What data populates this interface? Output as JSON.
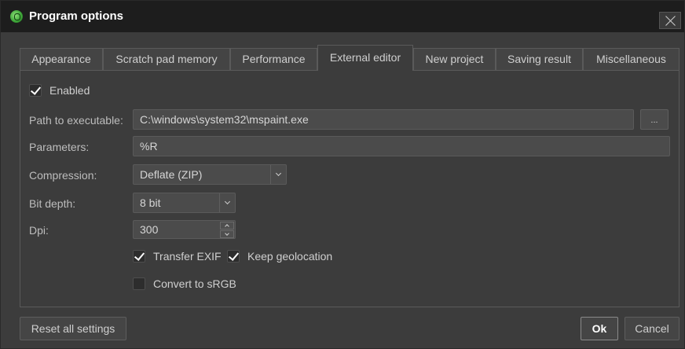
{
  "window": {
    "title": "Program options"
  },
  "tabs": [
    {
      "label": "Appearance"
    },
    {
      "label": "Scratch pad memory"
    },
    {
      "label": "Performance"
    },
    {
      "label": "External editor"
    },
    {
      "label": "New project"
    },
    {
      "label": "Saving result"
    },
    {
      "label": "Miscellaneous"
    }
  ],
  "active_tab": "External editor",
  "editor": {
    "enabled_label": "Enabled",
    "enabled": true,
    "path_label": "Path to executable:",
    "path_value": "C:\\windows\\system32\\mspaint.exe",
    "browse_label": "...",
    "params_label": "Parameters:",
    "params_value": "%R",
    "compression_label": "Compression:",
    "compression_value": "Deflate (ZIP)",
    "bitdepth_label": "Bit depth:",
    "bitdepth_value": "8 bit",
    "dpi_label": "Dpi:",
    "dpi_value": "300",
    "transfer_exif_label": "Transfer EXIF",
    "transfer_exif": true,
    "keep_geo_label": "Keep geolocation",
    "keep_geo": true,
    "srgb_label": "Convert to sRGB",
    "srgb": false
  },
  "footer": {
    "reset_label": "Reset all settings",
    "ok_label": "Ok",
    "cancel_label": "Cancel"
  },
  "icons": {
    "app": "app-logo-icon",
    "close": "close-icon",
    "check": "checkmark-icon",
    "dropdown": "chevron-down-icon"
  },
  "colors": {
    "background": "#3c3c3c",
    "titlebar": "#1d1d1d",
    "input": "#4b4b4b",
    "text": "#cfcfcf"
  }
}
